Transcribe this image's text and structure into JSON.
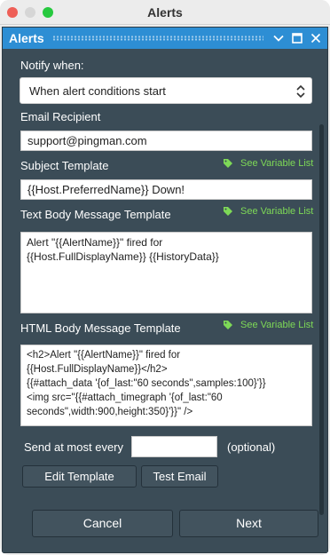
{
  "window": {
    "title": "Alerts"
  },
  "panel": {
    "title": "Alerts"
  },
  "notify": {
    "label": "Notify when:",
    "selected": "When alert conditions start"
  },
  "email": {
    "label": "Email Recipient",
    "value": "support@pingman.com"
  },
  "subject": {
    "label": "Subject Template",
    "link": "See Variable List",
    "value": "{{Host.PreferredName}} Down!"
  },
  "text_body": {
    "label": "Text Body Message Template",
    "link": "See Variable List",
    "value": "Alert \"{{AlertName}}\" fired for\n{{Host.FullDisplayName}} {{HistoryData}}"
  },
  "html_body": {
    "label": "HTML Body Message Template",
    "link": "See Variable List",
    "value": "<h2>Alert \"{{AlertName}}\" fired for\n{{Host.FullDisplayName}}</h2>\n{{#attach_data '{of_last:\"60 seconds\",samples:100}'}}\n<img src=\"{{#attach_timegraph '{of_last:\"60\nseconds\",width:900,height:350}'}}\" />"
  },
  "send": {
    "label": "Send at most every",
    "value": "",
    "optional": "(optional)"
  },
  "buttons": {
    "edit_template": "Edit Template",
    "test_email": "Test Email",
    "cancel": "Cancel",
    "next": "Next"
  },
  "colors": {
    "panel_bg": "#3b4c57",
    "header": "#2d8ed4",
    "link": "#7ed957",
    "button": "#42535e"
  },
  "icons": [
    "chevron-down-icon",
    "restore-icon",
    "close-icon",
    "tag-icon",
    "updown-arrows-icon"
  ]
}
